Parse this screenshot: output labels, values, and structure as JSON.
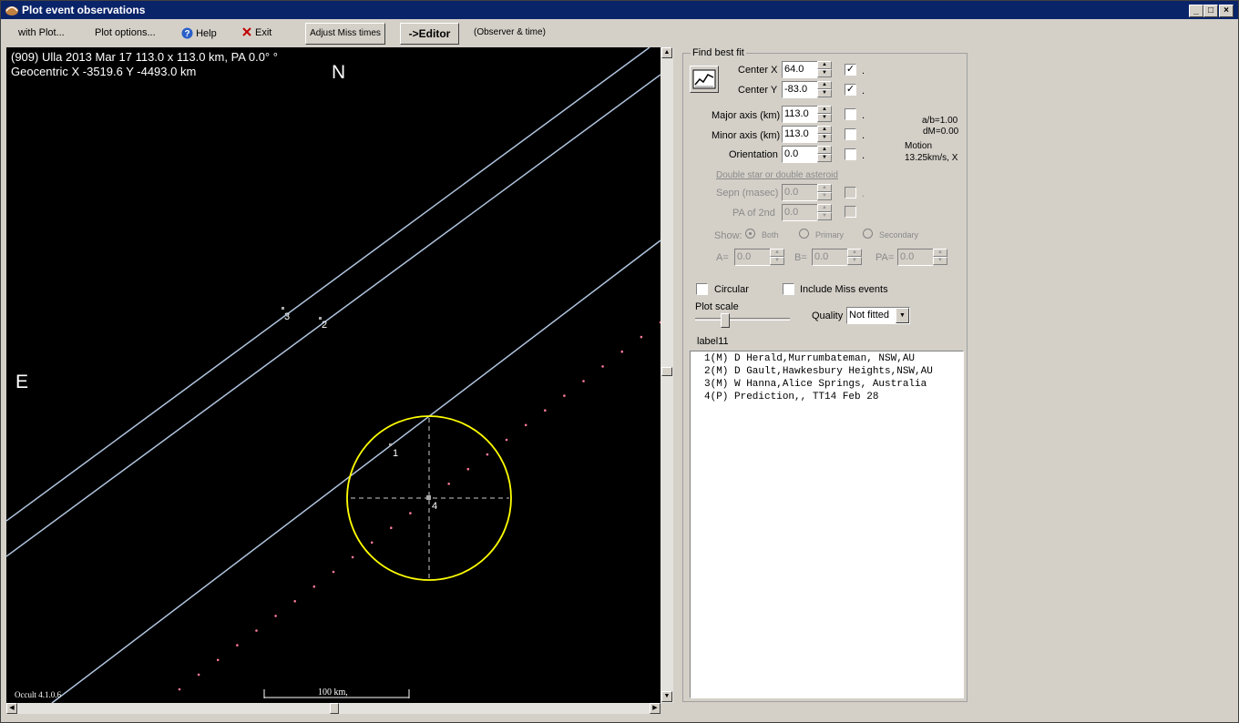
{
  "window": {
    "title": "Plot event observations",
    "minimize": "_",
    "maximize": "□",
    "close": "×"
  },
  "menubar": {
    "with_plot": "with Plot...",
    "plot_options": "Plot options...",
    "help": "Help",
    "exit": "Exit",
    "adjust_miss": "Adjust Miss times",
    "editor": "->Editor",
    "observer_time": "(Observer & time)"
  },
  "plot": {
    "header_line1": "(909) Ulla  2013 Mar 17   113.0 x 113.0 km, PA 0.0° °",
    "header_line2": "Geocentric X -3519.6  Y -4493.0 km",
    "north": "N",
    "east": "E",
    "version": "Occult 4.1.0.6",
    "scale_label": "100 km,",
    "chord_labels": [
      "1",
      "2",
      "3",
      "4"
    ]
  },
  "fit": {
    "group_title": "Find best fit",
    "center_x_label": "Center X",
    "center_x_value": "64.0",
    "center_y_label": "Center Y",
    "center_y_value": "-83.0",
    "major_label": "Major axis (km)",
    "major_value": "113.0",
    "minor_label": "Minor axis (km)",
    "minor_value": "113.0",
    "orient_label": "Orientation",
    "orient_value": "0.0",
    "dot": ".",
    "ab": "a/b=1.00",
    "dm": "dM=0.00",
    "motion_label": "Motion",
    "motion_value": "13.25km/s, X",
    "double_title": "Double star  or  double asteroid",
    "sepn_label": "Sepn (masec)",
    "sepn_value": "0.0",
    "pa2_label": "PA of 2nd",
    "pa2_value": "0.0",
    "show_label": "Show:",
    "both": "Both",
    "primary": "Primary",
    "secondary": "Secondary",
    "a_label": "A=",
    "a_value": "0.0",
    "b_label": "B=",
    "b_value": "0.0",
    "pa_label": "PA=",
    "pa_value": "0.0",
    "circular": "Circular",
    "include_miss": "Include Miss events",
    "plot_scale": "Plot scale",
    "quality_label": "Quality",
    "quality_value": "Not fitted",
    "label11": "label11",
    "check_mark": "✓"
  },
  "observers": [
    "1(M) D Herald,Murrumbateman, NSW,AU",
    "2(M) D Gault,Hawkesbury Heights,NSW,AU",
    "3(M) W Hanna,Alice Springs, Australia",
    "4(P) Prediction,, TT14 Feb 28"
  ],
  "colors": {
    "plot_bg": "#000000",
    "chord": "#b0c4de",
    "ellipse": "#ffff00",
    "prediction_dots": "#ff7a9a"
  }
}
